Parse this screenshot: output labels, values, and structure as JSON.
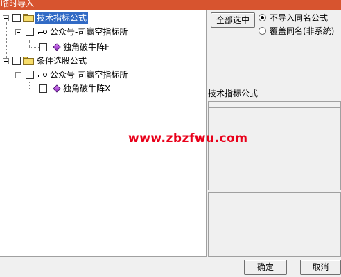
{
  "window": {
    "title": "临时导入"
  },
  "tree": {
    "categories": [
      {
        "label": "技术指标公式",
        "selected": true,
        "child": {
          "label": "公众号-司赢空指标所",
          "item": "独角破牛阵F"
        }
      },
      {
        "label": "条件选股公式",
        "selected": false,
        "child": {
          "label": "公众号-司赢空指标所",
          "item": "独角破牛阵X"
        }
      }
    ]
  },
  "actions": {
    "select_all_label": "全部选中"
  },
  "options": {
    "no_import_same_name": "不导入同名公式",
    "overwrite_same_name": "覆盖同名(非系统)",
    "selected": "no_import_same_name"
  },
  "info": {
    "category_label": "技术指标公式"
  },
  "watermark": "www.zbzfwu.com",
  "footer": {
    "ok_label": "确定",
    "cancel_label": "取消"
  },
  "colors": {
    "titlebar": "#d7542f",
    "selection": "#316ac5",
    "watermark": "#e8001a"
  }
}
